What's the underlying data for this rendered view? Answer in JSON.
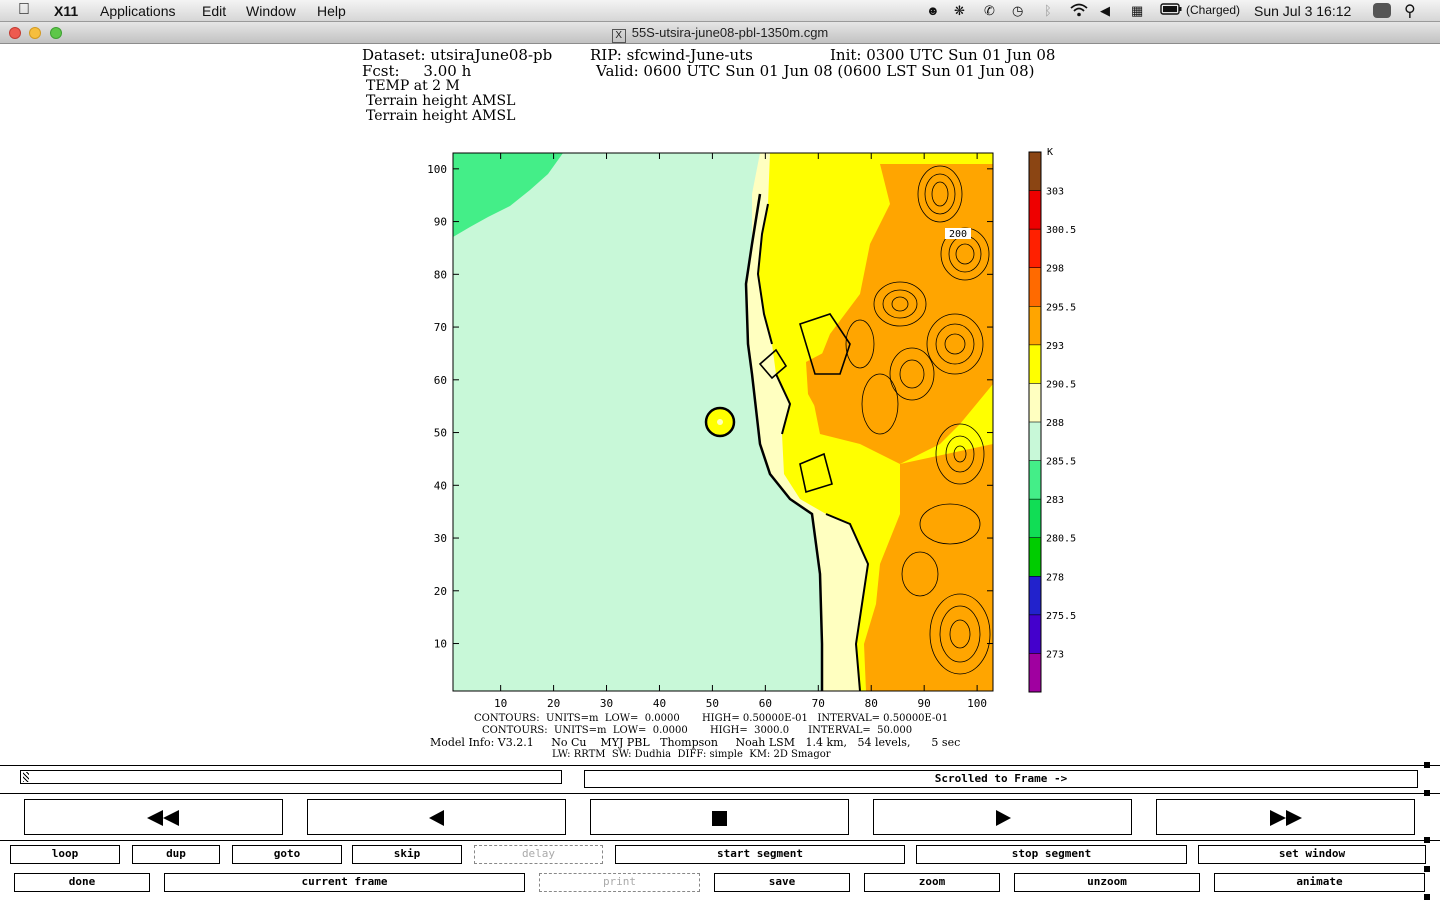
{
  "menubar": {
    "app": "X11",
    "items": [
      "Applications",
      "Edit",
      "Window",
      "Help"
    ],
    "battery": "(Charged)",
    "datetime": "Sun Jul 3  16:12"
  },
  "window": {
    "title": "55S-utsira-june08-pbl-1350m.cgm"
  },
  "header": {
    "line1_left": "Dataset: utsiraJune08-pb",
    "line1_mid": "RIP: sfcwind-June-uts",
    "line1_right": "Init: 0300 UTC Sun 01 Jun 08",
    "line2_left": "Fcst:     3.00 h",
    "line2_right": "Valid: 0600 UTC Sun 01 Jun 08 (0600 LST Sun 01 Jun 08)",
    "line3": "TEMP at 2 M",
    "line4": "Terrain height AMSL",
    "line5": "Terrain height AMSL"
  },
  "chart_data": {
    "type": "heatmap",
    "xlim": [
      1,
      103
    ],
    "ylim": [
      1,
      103
    ],
    "x_ticks": [
      10,
      20,
      30,
      40,
      50,
      60,
      70,
      80,
      90,
      100
    ],
    "y_ticks": [
      10,
      20,
      30,
      40,
      50,
      60,
      70,
      80,
      90,
      100
    ],
    "contour_label": "200",
    "colorbar": {
      "unit": "K",
      "labels": [
        "303",
        "300.5",
        "298",
        "295.5",
        "293",
        "290.5",
        "288",
        "285.5",
        "283",
        "280.5",
        "278",
        "275.5",
        "273"
      ],
      "colors": [
        "#8b4513",
        "#ee0000",
        "#ff2000",
        "#ff6a00",
        "#ffa500",
        "#ffff00",
        "#ffffc0",
        "#c8f8d8",
        "#44ee88",
        "#11dd55",
        "#00cc00",
        "#2222cc",
        "#4400cc",
        "#a000a0"
      ]
    },
    "footer": [
      "CONTOURS:  UNITS=m  LOW=  0.0000       HIGH= 0.50000E-01   INTERVAL= 0.50000E-01",
      "CONTOURS:  UNITS=m  LOW=  0.0000       HIGH=  3000.0      INTERVAL=  50.000",
      "Model Info: V3.2.1     No Cu    MYJ PBL   Thompson     Noah LSM   1.4 km,   54 levels,      5 sec",
      "LW: RRTM  SW: Dudhia  DIFF: simple  KM: 2D Smagor"
    ]
  },
  "controls": {
    "status": "Scrolled to Frame ->",
    "row1": [
      "loop",
      "dup",
      "goto",
      "skip",
      "delay",
      "start segment",
      "stop segment",
      "set window"
    ],
    "row2": [
      "done",
      "current frame",
      "print",
      "save",
      "zoom",
      "unzoom",
      "animate"
    ]
  }
}
